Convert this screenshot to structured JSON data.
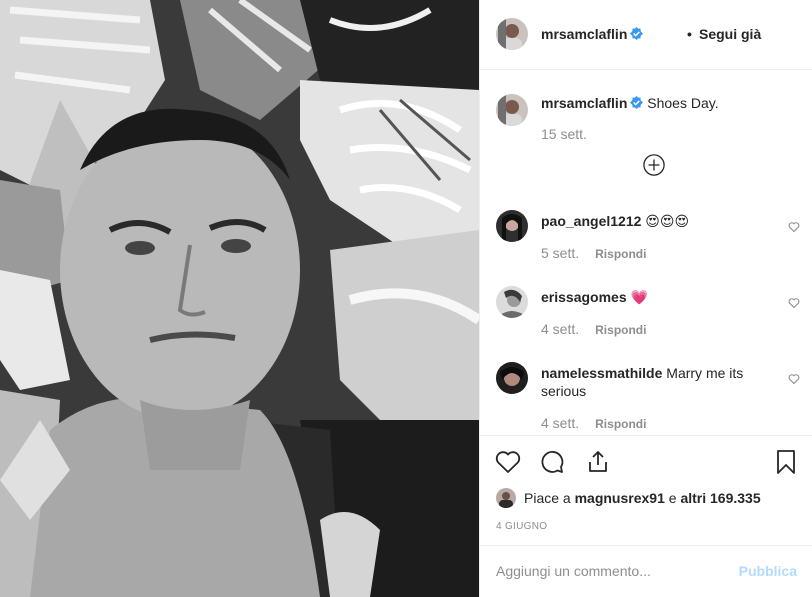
{
  "post": {
    "author": "mrsamclaflin",
    "follow_separator": "•",
    "follow_label": "Segui già",
    "photo_icon": "black-and-white-selfie-with-sneakers",
    "caption_text": "Shoes Day.",
    "caption_time": "15 sett.",
    "load_more_icon": "plus-circle-icon"
  },
  "comments": [
    {
      "user": "pao_angel1212",
      "text": "😍😍😍",
      "time": "5 sett.",
      "reply": "Rispondi"
    },
    {
      "user": "erissagomes",
      "text": "💗",
      "time": "4 sett.",
      "reply": "Rispondi"
    },
    {
      "user": "namelessmathilde",
      "text": "Marry me its serious",
      "time": "4 sett.",
      "reply": "Rispondi"
    }
  ],
  "actions": {
    "icons": [
      "heart-icon",
      "comment-icon",
      "share-icon",
      "bookmark-icon"
    ],
    "likes_prefix": "Piace a",
    "likes_user": "magnusrex91",
    "likes_and": "e",
    "likes_others": "altri 169.335",
    "date": "4 GIUGNO"
  },
  "add_comment": {
    "placeholder": "Aggiungi un commento...",
    "publish_label": "Pubblica"
  },
  "colors": {
    "text": "#262626",
    "muted": "#8e8e8e",
    "verified": "#3897f0",
    "publish_disabled": "#b3dbff",
    "divider": "#efefef"
  }
}
